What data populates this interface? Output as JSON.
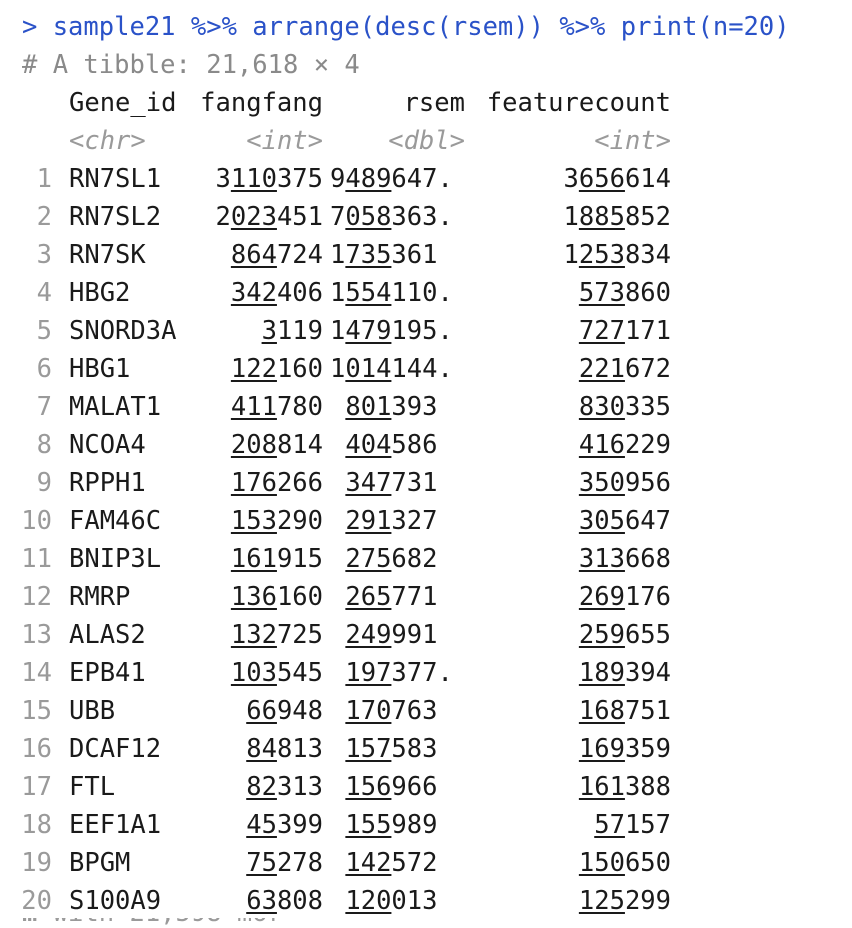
{
  "console": {
    "command": "> sample21 %>% arrange(desc(rsem)) %>% print(n=20)",
    "tibble_header": "# A tibble: 21,618 × 4",
    "columns": [
      "Gene_id",
      "fangfang",
      "rsem",
      "featurecount"
    ],
    "types": [
      "<chr>",
      "<int>",
      "<dbl>",
      "<int>"
    ],
    "rows": [
      {
        "n": "1",
        "gene": "RN7SL1",
        "fang": [
          "3",
          "110",
          "375"
        ],
        "rsem": [
          "9",
          "489",
          "647."
        ],
        "feat": [
          "3",
          "656",
          "614"
        ]
      },
      {
        "n": "2",
        "gene": "RN7SL2",
        "fang": [
          "2",
          "023",
          "451"
        ],
        "rsem": [
          "7",
          "058",
          "363."
        ],
        "feat": [
          "1",
          "885",
          "852"
        ]
      },
      {
        "n": "3",
        "gene": "RN7SK",
        "fang": [
          "",
          "864",
          "724"
        ],
        "rsem": [
          "1",
          "735",
          "361"
        ],
        "feat": [
          "1",
          "253",
          "834"
        ]
      },
      {
        "n": "4",
        "gene": "HBG2",
        "fang": [
          "",
          "342",
          "406"
        ],
        "rsem": [
          "1",
          "554",
          "110."
        ],
        "feat": [
          "",
          "573",
          "860"
        ]
      },
      {
        "n": "5",
        "gene": "SNORD3A",
        "fang": [
          "",
          "3",
          "119"
        ],
        "rsem": [
          "1",
          "479",
          "195."
        ],
        "feat": [
          "",
          "727",
          "171"
        ]
      },
      {
        "n": "6",
        "gene": "HBG1",
        "fang": [
          "",
          "122",
          "160"
        ],
        "rsem": [
          "1",
          "014",
          "144."
        ],
        "feat": [
          "",
          "221",
          "672"
        ]
      },
      {
        "n": "7",
        "gene": "MALAT1",
        "fang": [
          "",
          "411",
          "780"
        ],
        "rsem": [
          " ",
          "801",
          "393"
        ],
        "feat": [
          "",
          "830",
          "335"
        ]
      },
      {
        "n": "8",
        "gene": "NCOA4",
        "fang": [
          "",
          "208",
          "814"
        ],
        "rsem": [
          " ",
          "404",
          "586"
        ],
        "feat": [
          "",
          "416",
          "229"
        ]
      },
      {
        "n": "9",
        "gene": "RPPH1",
        "fang": [
          "",
          "176",
          "266"
        ],
        "rsem": [
          " ",
          "347",
          "731"
        ],
        "feat": [
          "",
          "350",
          "956"
        ]
      },
      {
        "n": "10",
        "gene": "FAM46C",
        "fang": [
          "",
          "153",
          "290"
        ],
        "rsem": [
          " ",
          "291",
          "327"
        ],
        "feat": [
          "",
          "305",
          "647"
        ]
      },
      {
        "n": "11",
        "gene": "BNIP3L",
        "fang": [
          "",
          "161",
          "915"
        ],
        "rsem": [
          " ",
          "275",
          "682"
        ],
        "feat": [
          "",
          "313",
          "668"
        ]
      },
      {
        "n": "12",
        "gene": "RMRP",
        "fang": [
          "",
          "136",
          "160"
        ],
        "rsem": [
          " ",
          "265",
          "771"
        ],
        "feat": [
          "",
          "269",
          "176"
        ]
      },
      {
        "n": "13",
        "gene": "ALAS2",
        "fang": [
          "",
          "132",
          "725"
        ],
        "rsem": [
          " ",
          "249",
          "991"
        ],
        "feat": [
          "",
          "259",
          "655"
        ]
      },
      {
        "n": "14",
        "gene": "EPB41",
        "fang": [
          "",
          "103",
          "545"
        ],
        "rsem": [
          " ",
          "197",
          "377."
        ],
        "feat": [
          "",
          "189",
          "394"
        ]
      },
      {
        "n": "15",
        "gene": "UBB",
        "fang": [
          "",
          "66",
          "948"
        ],
        "rsem": [
          " ",
          "170",
          "763"
        ],
        "feat": [
          "",
          "168",
          "751"
        ]
      },
      {
        "n": "16",
        "gene": "DCAF12",
        "fang": [
          "",
          "84",
          "813"
        ],
        "rsem": [
          " ",
          "157",
          "583"
        ],
        "feat": [
          "",
          "169",
          "359"
        ]
      },
      {
        "n": "17",
        "gene": "FTL",
        "fang": [
          "",
          "82",
          "313"
        ],
        "rsem": [
          " ",
          "156",
          "966"
        ],
        "feat": [
          "",
          "161",
          "388"
        ]
      },
      {
        "n": "18",
        "gene": "EEF1A1",
        "fang": [
          "",
          "45",
          "399"
        ],
        "rsem": [
          " ",
          "155",
          "989"
        ],
        "feat": [
          "",
          "57",
          "157"
        ]
      },
      {
        "n": "19",
        "gene": "BPGM",
        "fang": [
          "",
          "75",
          "278"
        ],
        "rsem": [
          " ",
          "142",
          "572"
        ],
        "feat": [
          "",
          "150",
          "650"
        ]
      },
      {
        "n": "20",
        "gene": "S100A9",
        "fang": [
          "",
          "63",
          "808"
        ],
        "rsem": [
          " ",
          "120",
          "013"
        ],
        "feat": [
          "",
          "125",
          "299"
        ]
      }
    ]
  }
}
